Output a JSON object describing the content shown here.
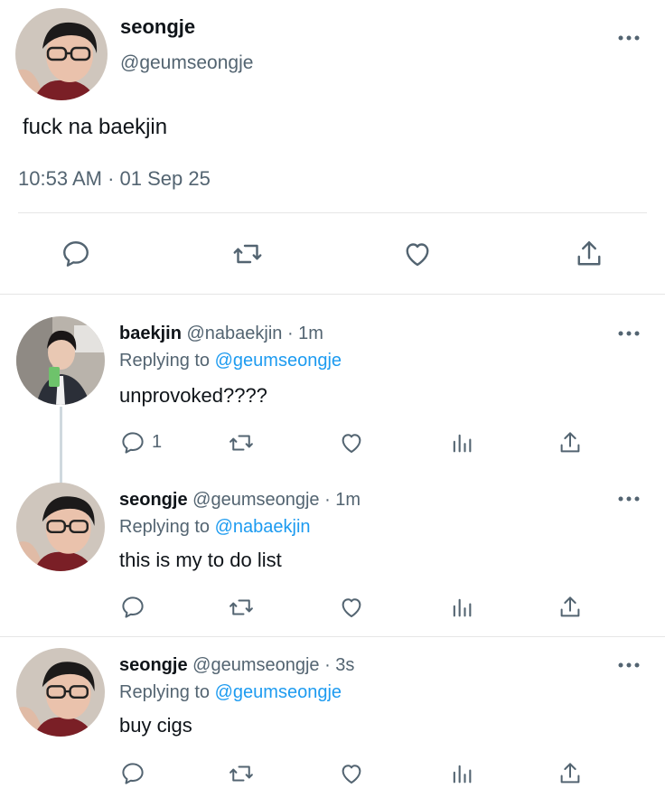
{
  "main_tweet": {
    "display_name": "seongje",
    "handle": "@geumseongje",
    "text": "fuck na baekjin",
    "timestamp": "10:53 AM · 01 Sep 25",
    "actions": [
      "reply-icon",
      "retweet-icon",
      "like-icon",
      "share-icon"
    ]
  },
  "replies": [
    {
      "display_name": "baekjin",
      "handle_time": "@nabaekjin · 1m",
      "replying_prefix": "Replying to",
      "replying_to": "@geumseongje",
      "text": "unprovoked????",
      "reply_count": "1"
    },
    {
      "display_name": "seongje",
      "handle_time": "@geumseongje · 1m",
      "replying_prefix": "Replying to",
      "replying_to": "@nabaekjin",
      "text": "this is my to do list",
      "reply_count": ""
    },
    {
      "display_name": "seongje",
      "handle_time": "@geumseongje · 3s",
      "replying_prefix": "Replying to",
      "replying_to": "@geumseongje",
      "text": "buy cigs",
      "reply_count": ""
    }
  ],
  "colors": {
    "accent": "#1d9bf0",
    "secondary_text": "#536471",
    "icon": "#536471",
    "divider": "#e6e6e6"
  }
}
